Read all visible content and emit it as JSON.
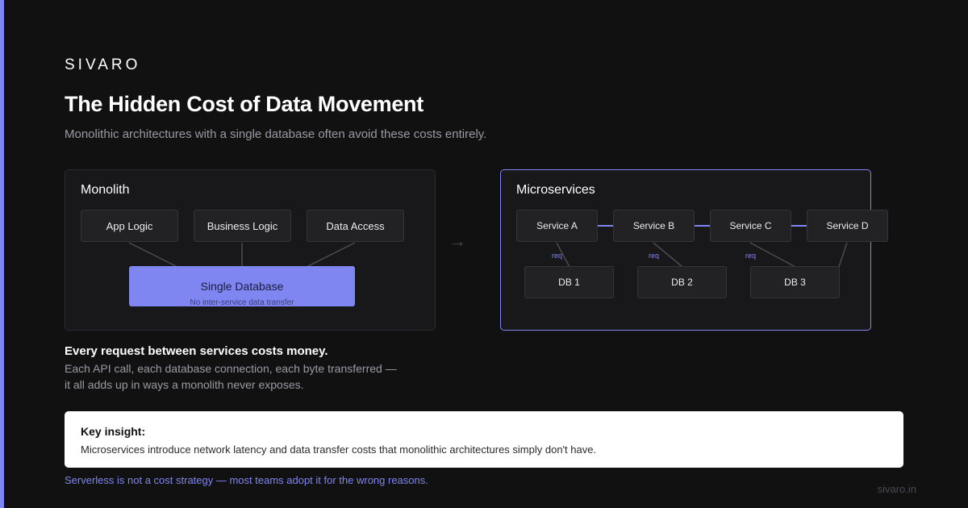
{
  "brand": "SIVARO",
  "title": "The Hidden Cost of Data Movement",
  "subtitle": "Monolithic architectures with a single database often avoid these costs entirely.",
  "monolith": {
    "title": "Monolith",
    "modules": [
      "App Logic",
      "Business Logic",
      "Data Access"
    ],
    "database": "Single Database",
    "database_note": "No inter-service data transfer"
  },
  "arrow": "→",
  "microservices": {
    "title": "Microservices",
    "services": [
      "Service A",
      "Service B",
      "Service C",
      "Service D"
    ],
    "databases": [
      "DB 1",
      "DB 2",
      "DB 3"
    ],
    "link_label": "req"
  },
  "cost": {
    "heading": "Every request between services costs money.",
    "line1": "Each API call, each database connection, each byte transferred —",
    "line2": "it all adds up in ways a monolith never exposes."
  },
  "insight": {
    "title": "Key insight:",
    "text": "Microservices introduce network latency and data transfer costs that monolithic architectures simply don't have."
  },
  "footer_note": "Serverless is not a cost strategy — most teams adopt it for the wrong reasons.",
  "site": "sivaro.in",
  "colors": {
    "accent": "#7f86f2",
    "background": "#111112",
    "panel": "#18181b"
  }
}
